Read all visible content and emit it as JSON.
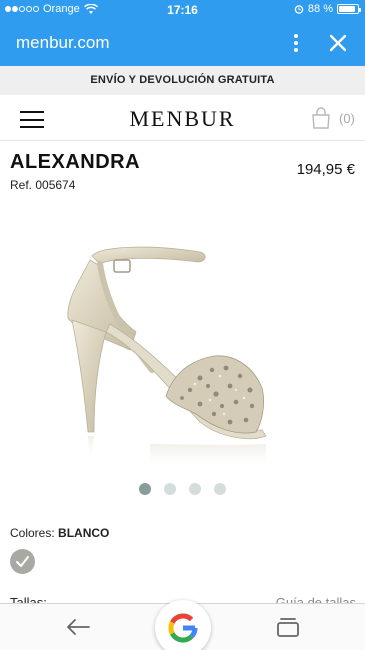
{
  "status_bar": {
    "carrier": "Orange",
    "time": "17:16",
    "battery": "88 %",
    "battery_level": 0.88,
    "icons": [
      "signal-dots-icon",
      "wifi-icon",
      "alarm-icon",
      "battery-icon"
    ]
  },
  "browser": {
    "url": "menbur.com",
    "icons": [
      "more-vert-icon",
      "close-icon"
    ]
  },
  "promo": {
    "text": "ENVÍO Y DEVOLUCIÓN GRATUITA"
  },
  "site_header": {
    "logo": "MENBUR",
    "cart_count": "(0)",
    "icons": [
      "hamburger-menu-icon",
      "shopping-bag-icon"
    ]
  },
  "product": {
    "name": "ALEXANDRA",
    "ref": "Ref. 005674",
    "price": "194,95 €",
    "image": "champagne-satin-heeled-sandal-image",
    "carousel": {
      "total": 4,
      "active_index": 0
    }
  },
  "colors": {
    "label": "Colores:",
    "selected": "BLANCO",
    "swatch_color": "#a9a9a3"
  },
  "sizes": {
    "label": "Tallas:",
    "guide_link": "Guía de tallas"
  },
  "bottom_bar": {
    "icons": [
      "back-arrow-icon",
      "google-icon",
      "tabs-icon"
    ]
  },
  "colors_theme": {
    "browser_blue": "#2f9cf0",
    "promo_bg": "#efefef",
    "dot_active": "#8a9c9a",
    "dot_inactive": "#d5dcdc"
  }
}
